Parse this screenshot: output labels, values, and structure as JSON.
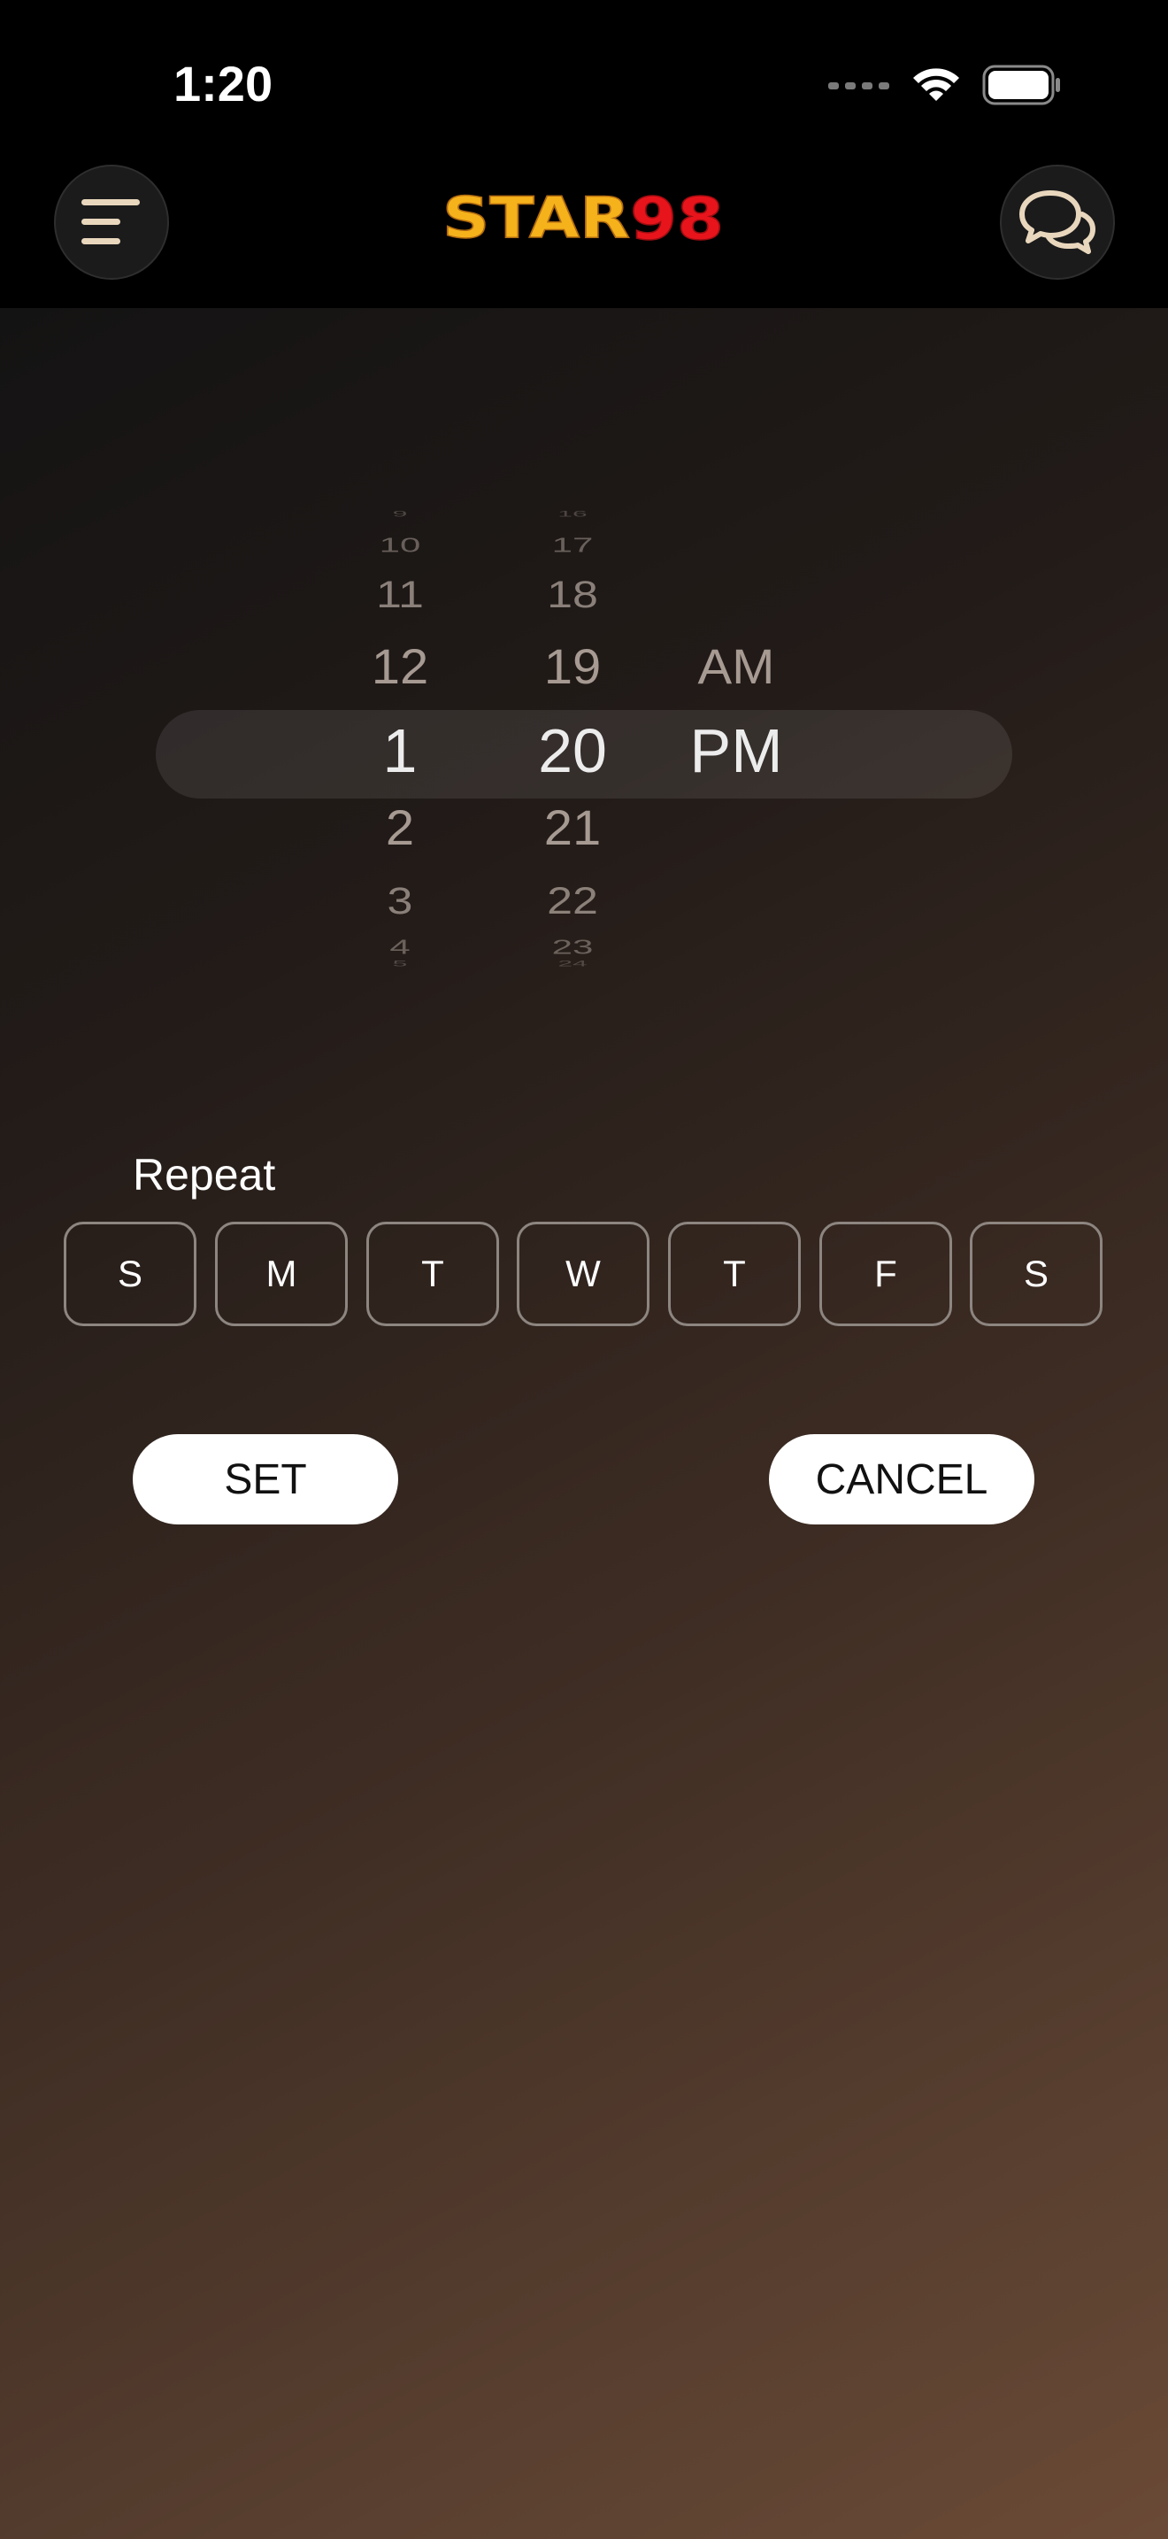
{
  "status_bar": {
    "time": "1:20"
  },
  "header": {
    "logo_text_a": "STAR",
    "logo_text_b": "98",
    "menu_icon": "menu-icon",
    "chat_icon": "chat-bubbles-icon"
  },
  "picker": {
    "hours": [
      "9",
      "10",
      "11",
      "12",
      "1",
      "2",
      "3",
      "4",
      "5"
    ],
    "minutes": [
      "16",
      "17",
      "18",
      "19",
      "20",
      "21",
      "22",
      "23",
      "24"
    ],
    "ampm": [
      "AM",
      "PM"
    ],
    "selected_hour": "1",
    "selected_minute": "20",
    "selected_ampm": "PM"
  },
  "repeat": {
    "label": "Repeat",
    "days": [
      "S",
      "M",
      "T",
      "W",
      "T",
      "F",
      "S"
    ]
  },
  "actions": {
    "set_label": "SET",
    "cancel_label": "CANCEL"
  },
  "colors": {
    "logo_star": "#f6b21b",
    "logo_98": "#e8141c",
    "icon_tint": "#e9d7bd"
  }
}
